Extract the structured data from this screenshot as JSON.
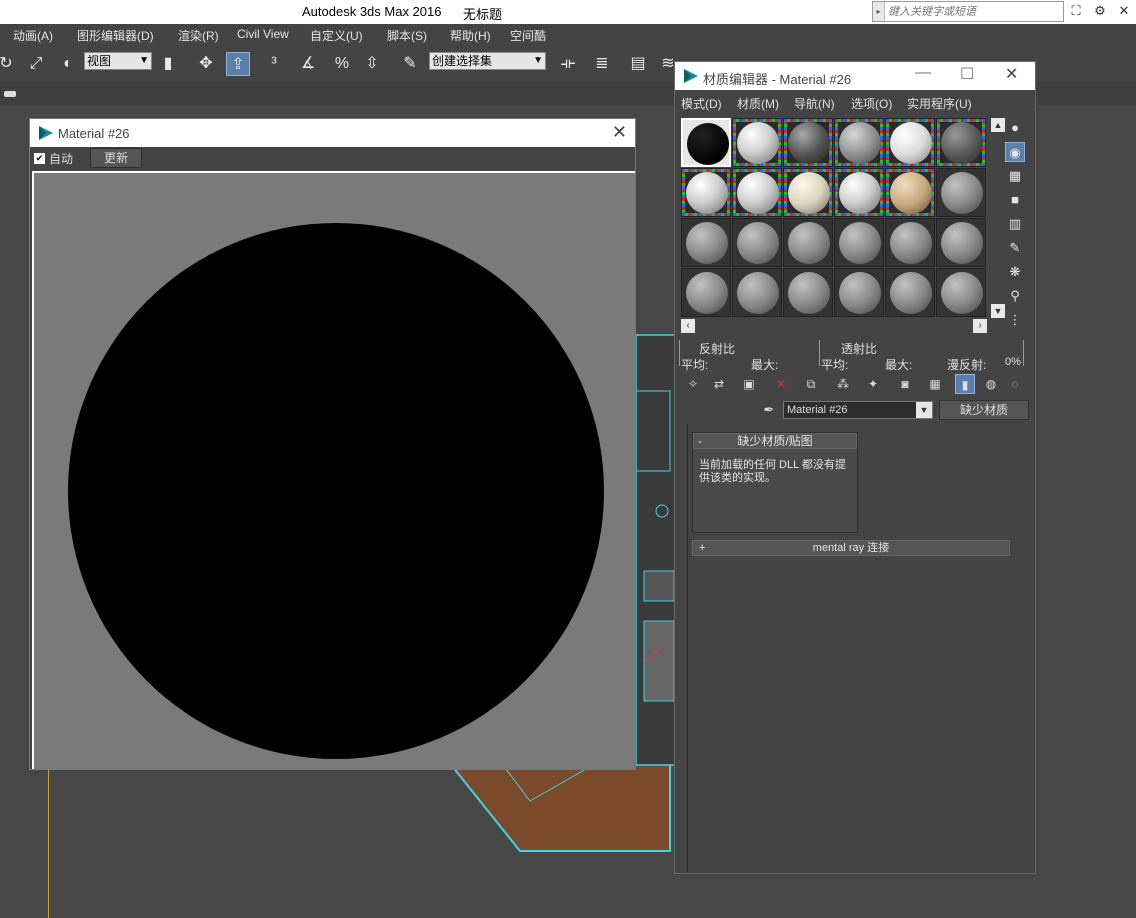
{
  "app": {
    "title": "Autodesk 3ds Max 2016",
    "document": "无标题",
    "search_placeholder": "键入关键字或短语"
  },
  "menubar": {
    "items": [
      "动画(A)",
      "图形编辑器(D)",
      "渲染(R)",
      "Civil View",
      "自定义(U)",
      "脚本(S)",
      "帮助(H)",
      "空间酷"
    ]
  },
  "toolbar": {
    "view_select": "视图",
    "selection_set": "创建选择集"
  },
  "preview_window": {
    "title": "Material #26",
    "auto_label": "自动",
    "update_button": "更新"
  },
  "material_editor": {
    "title": "材质编辑器 - Material #26",
    "menu": [
      "模式(D)",
      "材质(M)",
      "导航(N)",
      "选项(O)",
      "实用程序(U)"
    ],
    "stats": {
      "reflectance": "反射比",
      "transmittance": "透射比",
      "avg_label": "平均:",
      "max_label": "最大:",
      "avg_label2": "平均:",
      "max_label2": "最大:",
      "diffuse_label": "漫反射:",
      "diffuse_value": "0%"
    },
    "material_name": "Material #26",
    "material_type": "缺少材质",
    "rollout_missing": {
      "title": "缺少材质/贴图",
      "sign": "-",
      "message": "当前加载的任何 DLL 都没有提供该类的实现。"
    },
    "rollout_mentalray": {
      "title": "mental ray 连接",
      "sign": "+"
    },
    "slots": [
      {
        "kind": "black"
      },
      {
        "kind": "white"
      },
      {
        "kind": "dark"
      },
      {
        "kind": "noisy"
      },
      {
        "kind": "bright"
      },
      {
        "kind": "noisydark"
      },
      {
        "kind": "white"
      },
      {
        "kind": "white"
      },
      {
        "kind": "cream"
      },
      {
        "kind": "white"
      },
      {
        "kind": "tile"
      },
      {
        "kind": "gray"
      },
      {
        "kind": "gray"
      },
      {
        "kind": "gray"
      },
      {
        "kind": "gray"
      },
      {
        "kind": "gray"
      },
      {
        "kind": "gray"
      },
      {
        "kind": "gray"
      },
      {
        "kind": "gray"
      },
      {
        "kind": "gray"
      },
      {
        "kind": "gray"
      },
      {
        "kind": "gray"
      },
      {
        "kind": "gray"
      },
      {
        "kind": "gray"
      }
    ]
  },
  "colors": {
    "accent": "#5a7fa8",
    "viewport_line": "#c9a227",
    "scene_outline": "#3cd4e6"
  }
}
